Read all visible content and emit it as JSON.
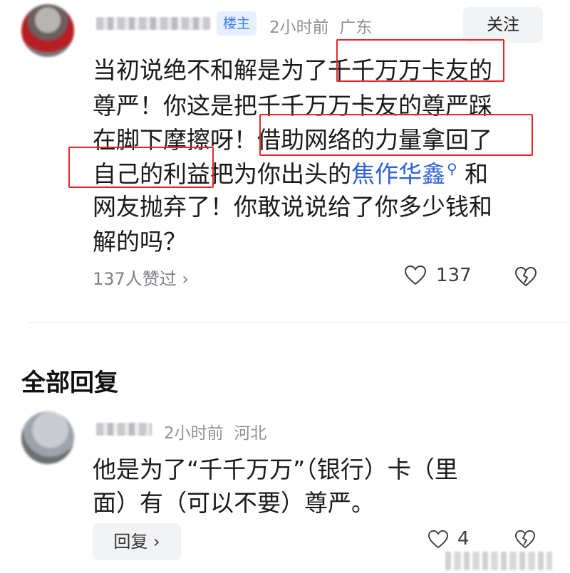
{
  "main_comment": {
    "badge": "楼主",
    "time": "2小时前",
    "location": "广东",
    "follow_label": "关注",
    "lines": [
      "当初说绝不和解是为了千千万万卡友的",
      "尊严！你这是把千千万万卡友的尊严踩",
      "在脚下摩擦呀！借助网络的力量拿回了",
      "网友抛弃了！你敢说说给了你多少钱和",
      "解的吗？"
    ],
    "line4_before": "自己的利益把为你出头的",
    "line4_link": "焦作华鑫",
    "line4_after": "和",
    "likes_link": "137人赞过 ›",
    "like_count": "137"
  },
  "section_title": "全部回复",
  "reply": {
    "time": "2小时前",
    "location": "河北",
    "lines": [
      "他是为了“千千万万”（银行）卡（里",
      "面）有（可以不要）尊严。"
    ],
    "reply_button": "回复 ›",
    "like_count": "4"
  },
  "icons": {
    "like": "heart-outline-icon",
    "dislike": "broken-heart-icon",
    "search": "search-icon"
  },
  "colors": {
    "link_blue": "#2f63d6",
    "badge_blue": "#3e7bf2",
    "highlight_red": "#e8262a"
  }
}
